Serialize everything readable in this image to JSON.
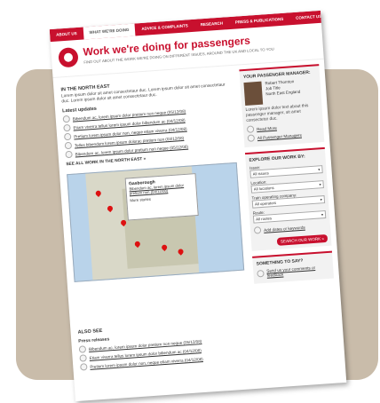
{
  "nav": [
    "ABOUT US",
    "WHAT WE'RE DOING",
    "ADVICE & COMPLAINTS",
    "RESEARCH",
    "PRESS & PUBLICATIONS",
    "CONTACT US"
  ],
  "header": {
    "title": "Work we're doing for passengers",
    "subtitle": "FIND OUT ABOUT THE WORK WE'RE DOING ON DIFFERENT ISSUES, AROUND THE UK AND LOCAL TO YOU"
  },
  "north_east": {
    "heading": "IN THE NORTH EAST",
    "intro": "Lorem ipsum dolor sit amet consectetaur duc. Lorem ipsum dolor sit amet consectetaur duc. Lorem ipsum dolor sit amet consectetaur duc.",
    "updates_heading": "Latest updates",
    "updates": [
      "Bibendum ac, lorem ipsum dolor pretium non neque (05/12/08)",
      "Etiam viverra tellus lorem ipsum dolor bibendum ac (04/12/08)",
      "Pretium lorem ipsum dolor non, neque etiam viverra (04/12/08)",
      "Tellus bibendum lorem ipsum dolorac pretium non (03/12/08)",
      "Bibendum ac, lorem ipsum dolor pretium non neque (05/12/08)"
    ],
    "see_all": "SEE ALL WORK IN THE NORTH EAST »"
  },
  "map_popup": {
    "title": "Gasborough",
    "link": "Bibendum ac, lorem ipsum dolor pretium non (04/12/08)",
    "more": "More stories"
  },
  "manager": {
    "heading": "YOUR PASSENGER MANAGER:",
    "name": "Robert Thornton",
    "job": "Job Title",
    "region": "North East England",
    "text": "Lorem ipsum dolor text about this passenger manager, sit amet consectetur duc.",
    "read_more": "Read More",
    "all_managers": "All Passenger Managers"
  },
  "explore": {
    "heading": "EXPLORE OUR WORK BY:",
    "issue_label": "Issue:",
    "issue_value": "All issues",
    "location_label": "Location:",
    "location_value": "All locations",
    "operator_label": "Train operating company:",
    "operator_value": "All operators",
    "route_label": "Route:",
    "route_value": "All routes",
    "add_dates": "Add dates or keywords",
    "search_button": "SEARCH OUR WORK »"
  },
  "say": {
    "heading": "SOMETHING TO SAY?",
    "link": "Send us your comments or feedback"
  },
  "also_see": {
    "heading": "ALSO SEE",
    "sub": "Press releases",
    "items": [
      "Bibendum ac, lorem ipsum dolor pretium non neque (05/12/08)",
      "Etiam viverra tellus lorem ipsum dolor bibendum ac (04/12/08)",
      "Pretium lorem ipsum dolor non, neque etiam viverra (04/12/08)"
    ]
  },
  "colors": {
    "brand": "#c8102e",
    "backdrop": "#c9bcaa"
  }
}
